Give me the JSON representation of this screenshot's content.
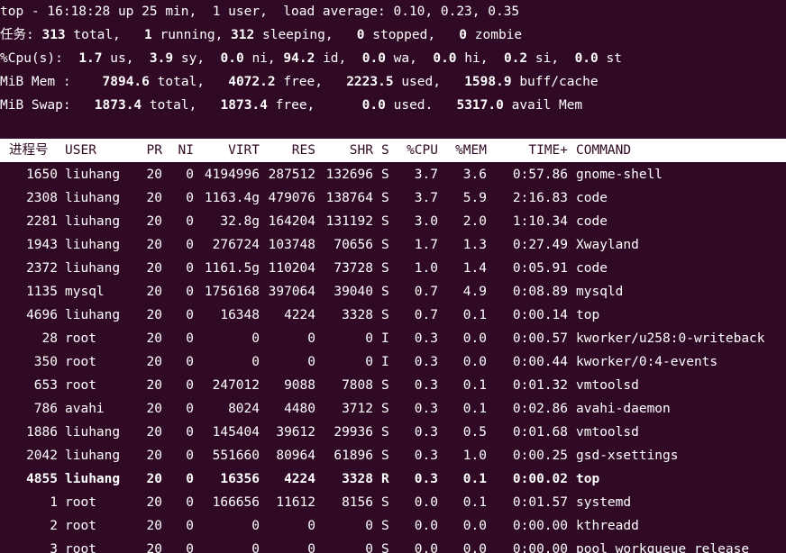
{
  "summary": {
    "line1": "top - 16:18:28 up 25 min,  1 user,  load average: 0.10, 0.23, 0.35",
    "tasks": {
      "label": "任务:",
      "total": "313",
      "total_label": "total,",
      "running": "1",
      "running_label": "running,",
      "sleeping": "312",
      "sleeping_label": "sleeping,",
      "stopped": "0",
      "stopped_label": "stopped,",
      "zombie": "0",
      "zombie_label": "zombie"
    },
    "cpu": {
      "label": "%Cpu(s):",
      "us": "1.7",
      "us_label": "us,",
      "sy": "3.9",
      "sy_label": "sy,",
      "ni": "0.0",
      "ni_label": "ni,",
      "id": "94.2",
      "id_label": "id,",
      "wa": "0.0",
      "wa_label": "wa,",
      "hi": "0.0",
      "hi_label": "hi,",
      "si": "0.2",
      "si_label": "si,",
      "st": "0.0",
      "st_label": "st"
    },
    "mem": {
      "label": "MiB Mem :",
      "total": "7894.6",
      "total_label": "total,",
      "free": "4072.2",
      "free_label": "free,",
      "used": "2223.5",
      "used_label": "used,",
      "buff": "1598.9",
      "buff_label": "buff/cache"
    },
    "swap": {
      "label": "MiB Swap:",
      "total": "1873.4",
      "total_label": "total,",
      "free": "1873.4",
      "free_label": "free,",
      "used": "0.0",
      "used_label": "used.",
      "avail": "5317.0",
      "avail_label": "avail Mem"
    }
  },
  "header": {
    "pid": "进程号",
    "user": "USER",
    "pr": "PR",
    "ni": "NI",
    "virt": "VIRT",
    "res": "RES",
    "shr": "SHR",
    "s": "S",
    "cpu": "%CPU",
    "mem": "%MEM",
    "time": "TIME+",
    "command": "COMMAND"
  },
  "processes": [
    {
      "pid": "1650",
      "user": "liuhang",
      "pr": "20",
      "ni": "0",
      "virt": "4194996",
      "res": "287512",
      "shr": "132696",
      "s": "S",
      "cpu": "3.7",
      "mem": "3.6",
      "time": "0:57.86",
      "command": "gnome-shell"
    },
    {
      "pid": "2308",
      "user": "liuhang",
      "pr": "20",
      "ni": "0",
      "virt": "1163.4g",
      "res": "479076",
      "shr": "138764",
      "s": "S",
      "cpu": "3.7",
      "mem": "5.9",
      "time": "2:16.83",
      "command": "code"
    },
    {
      "pid": "2281",
      "user": "liuhang",
      "pr": "20",
      "ni": "0",
      "virt": "32.8g",
      "res": "164204",
      "shr": "131192",
      "s": "S",
      "cpu": "3.0",
      "mem": "2.0",
      "time": "1:10.34",
      "command": "code"
    },
    {
      "pid": "1943",
      "user": "liuhang",
      "pr": "20",
      "ni": "0",
      "virt": "276724",
      "res": "103748",
      "shr": "70656",
      "s": "S",
      "cpu": "1.7",
      "mem": "1.3",
      "time": "0:27.49",
      "command": "Xwayland"
    },
    {
      "pid": "2372",
      "user": "liuhang",
      "pr": "20",
      "ni": "0",
      "virt": "1161.5g",
      "res": "110204",
      "shr": "73728",
      "s": "S",
      "cpu": "1.0",
      "mem": "1.4",
      "time": "0:05.91",
      "command": "code"
    },
    {
      "pid": "1135",
      "user": "mysql",
      "pr": "20",
      "ni": "0",
      "virt": "1756168",
      "res": "397064",
      "shr": "39040",
      "s": "S",
      "cpu": "0.7",
      "mem": "4.9",
      "time": "0:08.89",
      "command": "mysqld"
    },
    {
      "pid": "4696",
      "user": "liuhang",
      "pr": "20",
      "ni": "0",
      "virt": "16348",
      "res": "4224",
      "shr": "3328",
      "s": "S",
      "cpu": "0.7",
      "mem": "0.1",
      "time": "0:00.14",
      "command": "top"
    },
    {
      "pid": "28",
      "user": "root",
      "pr": "20",
      "ni": "0",
      "virt": "0",
      "res": "0",
      "shr": "0",
      "s": "I",
      "cpu": "0.3",
      "mem": "0.0",
      "time": "0:00.57",
      "command": "kworker/u258:0-writeback"
    },
    {
      "pid": "350",
      "user": "root",
      "pr": "20",
      "ni": "0",
      "virt": "0",
      "res": "0",
      "shr": "0",
      "s": "I",
      "cpu": "0.3",
      "mem": "0.0",
      "time": "0:00.44",
      "command": "kworker/0:4-events"
    },
    {
      "pid": "653",
      "user": "root",
      "pr": "20",
      "ni": "0",
      "virt": "247012",
      "res": "9088",
      "shr": "7808",
      "s": "S",
      "cpu": "0.3",
      "mem": "0.1",
      "time": "0:01.32",
      "command": "vmtoolsd"
    },
    {
      "pid": "786",
      "user": "avahi",
      "pr": "20",
      "ni": "0",
      "virt": "8024",
      "res": "4480",
      "shr": "3712",
      "s": "S",
      "cpu": "0.3",
      "mem": "0.1",
      "time": "0:02.86",
      "command": "avahi-daemon"
    },
    {
      "pid": "1886",
      "user": "liuhang",
      "pr": "20",
      "ni": "0",
      "virt": "145404",
      "res": "39612",
      "shr": "29936",
      "s": "S",
      "cpu": "0.3",
      "mem": "0.5",
      "time": "0:01.68",
      "command": "vmtoolsd"
    },
    {
      "pid": "2042",
      "user": "liuhang",
      "pr": "20",
      "ni": "0",
      "virt": "551660",
      "res": "80964",
      "shr": "61896",
      "s": "S",
      "cpu": "0.3",
      "mem": "1.0",
      "time": "0:00.25",
      "command": "gsd-xsettings"
    },
    {
      "pid": "4855",
      "user": "liuhang",
      "pr": "20",
      "ni": "0",
      "virt": "16356",
      "res": "4224",
      "shr": "3328",
      "s": "R",
      "cpu": "0.3",
      "mem": "0.1",
      "time": "0:00.02",
      "command": "top",
      "bold": true
    },
    {
      "pid": "1",
      "user": "root",
      "pr": "20",
      "ni": "0",
      "virt": "166656",
      "res": "11612",
      "shr": "8156",
      "s": "S",
      "cpu": "0.0",
      "mem": "0.1",
      "time": "0:01.57",
      "command": "systemd"
    },
    {
      "pid": "2",
      "user": "root",
      "pr": "20",
      "ni": "0",
      "virt": "0",
      "res": "0",
      "shr": "0",
      "s": "S",
      "cpu": "0.0",
      "mem": "0.0",
      "time": "0:00.00",
      "command": "kthreadd"
    },
    {
      "pid": "3",
      "user": "root",
      "pr": "20",
      "ni": "0",
      "virt": "0",
      "res": "0",
      "shr": "0",
      "s": "S",
      "cpu": "0.0",
      "mem": "0.0",
      "time": "0:00.00",
      "command": "pool_workqueue_release"
    }
  ],
  "colors": {
    "background": "#300a24",
    "foreground": "#ffffff",
    "header_background": "#ffffff",
    "header_foreground": "#300a24"
  }
}
